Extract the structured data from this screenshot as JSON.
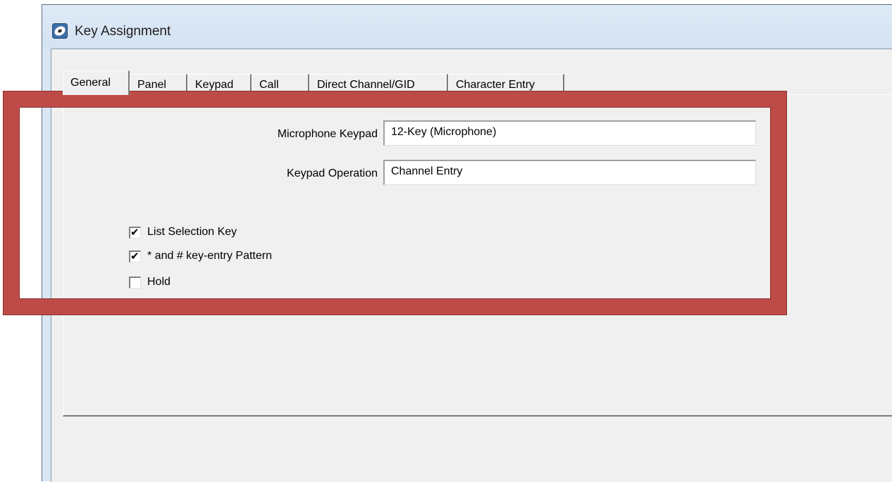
{
  "window": {
    "title": "Key Assignment",
    "icon": "app-disc-icon"
  },
  "tabs": [
    {
      "label": "General",
      "active": true
    },
    {
      "label": "Panel",
      "active": false
    },
    {
      "label": "Keypad",
      "active": false
    },
    {
      "label": "Call",
      "active": false
    },
    {
      "label": "Direct Channel/GID",
      "active": false
    },
    {
      "label": "Character Entry",
      "active": false
    }
  ],
  "fields": {
    "microphone_keypad": {
      "label": "Microphone Keypad",
      "value": "12-Key (Microphone)"
    },
    "keypad_operation": {
      "label": "Keypad Operation",
      "value": "Channel Entry"
    }
  },
  "checkboxes": [
    {
      "label": "List Selection Key",
      "checked": true
    },
    {
      "label": "* and # key-entry Pattern",
      "checked": true
    },
    {
      "label": "Hold",
      "checked": false
    }
  ],
  "highlight": {
    "color": "#be4b48"
  }
}
